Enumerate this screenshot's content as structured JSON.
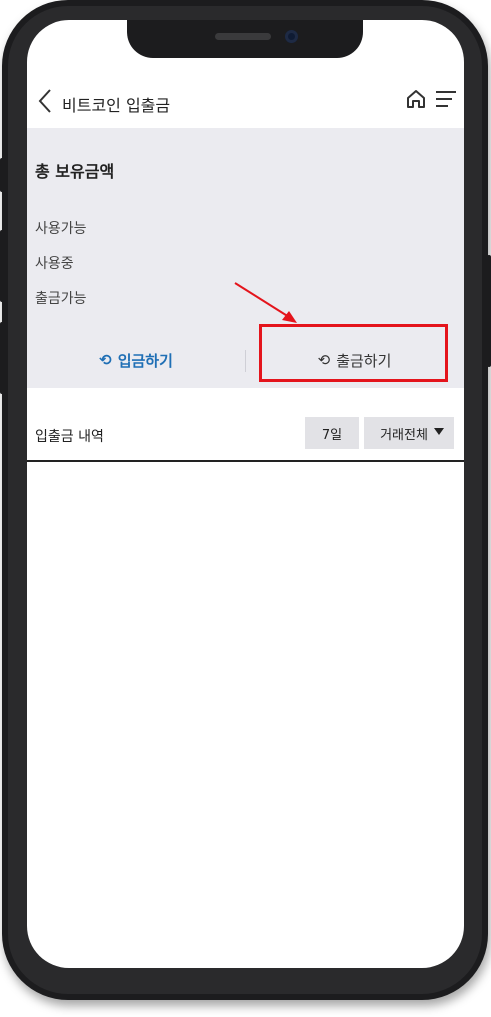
{
  "header": {
    "title": "비트코인 입출금",
    "back_icon": "chevron-left-icon",
    "home_icon": "home-icon",
    "menu_icon": "menu-icon"
  },
  "summary": {
    "total_label": "총 보유금액",
    "rows": [
      "사용가능",
      "사용중",
      "출금가능"
    ]
  },
  "actions": {
    "deposit_label": "입금하기",
    "withdraw_label": "출금하기",
    "deposit_icon": "refresh-icon",
    "withdraw_icon": "refresh-icon",
    "deposit_color": "#1f6fb5"
  },
  "annotation": {
    "highlight_color": "#e4141c"
  },
  "history": {
    "label": "입출금 내역",
    "period_filter": "7일",
    "type_filter": "거래전체"
  }
}
